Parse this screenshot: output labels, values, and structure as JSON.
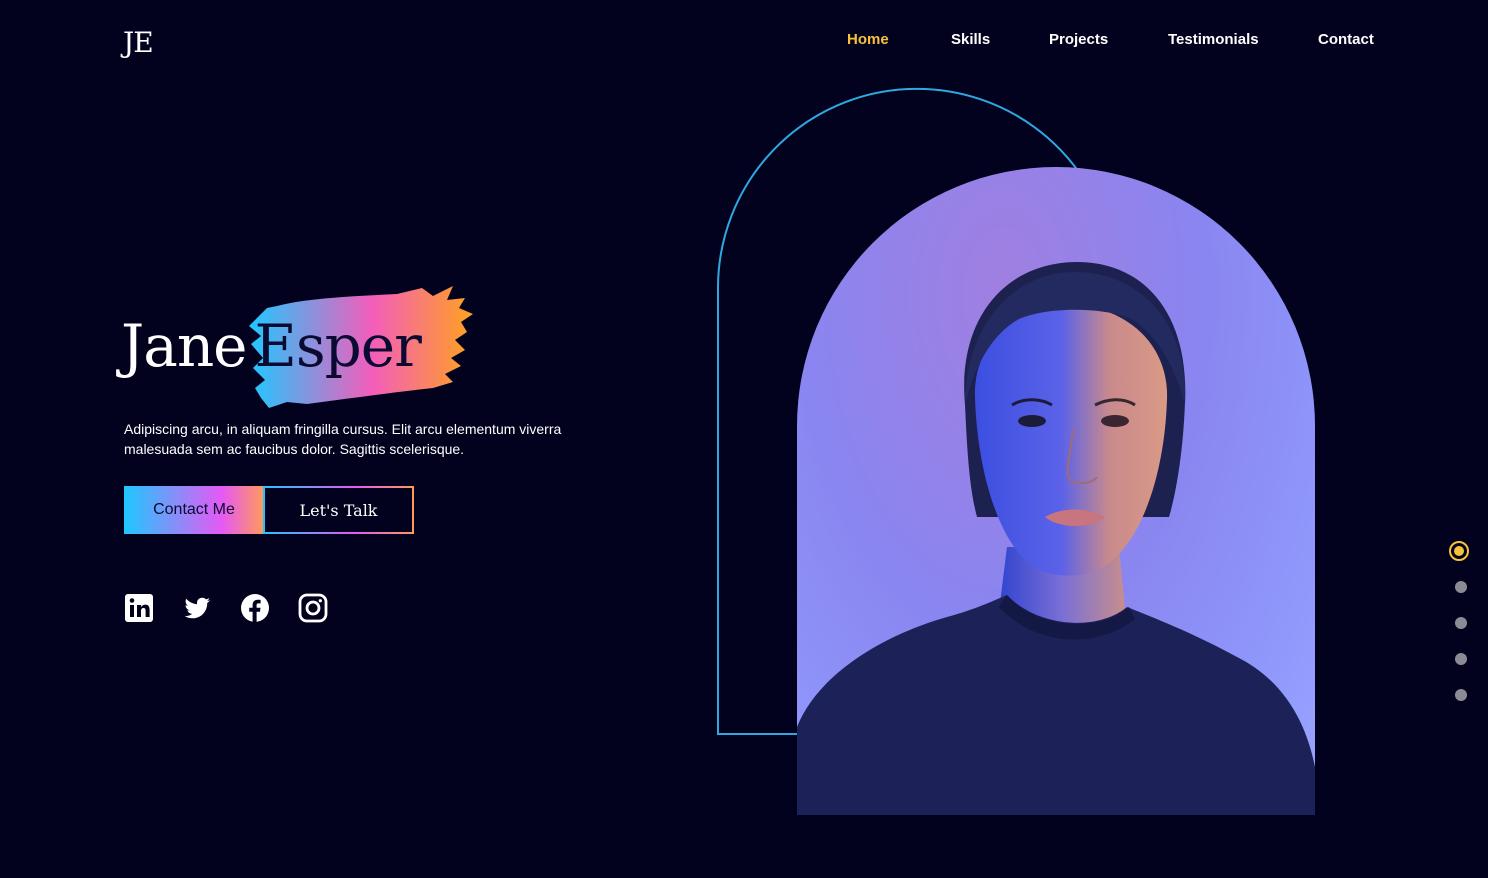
{
  "header": {
    "logo": "JE",
    "nav": [
      {
        "label": "Home",
        "active": true
      },
      {
        "label": "Skills",
        "active": false
      },
      {
        "label": "Projects",
        "active": false
      },
      {
        "label": "Testimonials",
        "active": false
      },
      {
        "label": "Contact",
        "active": false
      }
    ]
  },
  "hero": {
    "first_name": "Jane",
    "last_name": "Esper",
    "description": "Adipiscing arcu, in aliquam fringilla cursus. Elit arcu elementum viverra malesuada sem ac faucibus dolor. Sagittis scelerisque.",
    "primary_button": "Contact Me",
    "secondary_button": "Let's Talk",
    "socials": [
      "linkedin-icon",
      "twitter-icon",
      "facebook-icon",
      "instagram-icon"
    ]
  },
  "section_dots": {
    "count": 5,
    "active_index": 0
  },
  "colors": {
    "background": "#03021e",
    "accent": "#f7c23b",
    "gradient_start": "#1fc8ff",
    "gradient_mid": "#e559f4",
    "gradient_end": "#ff9a5a",
    "arch_outline": "#2ea8e0"
  }
}
